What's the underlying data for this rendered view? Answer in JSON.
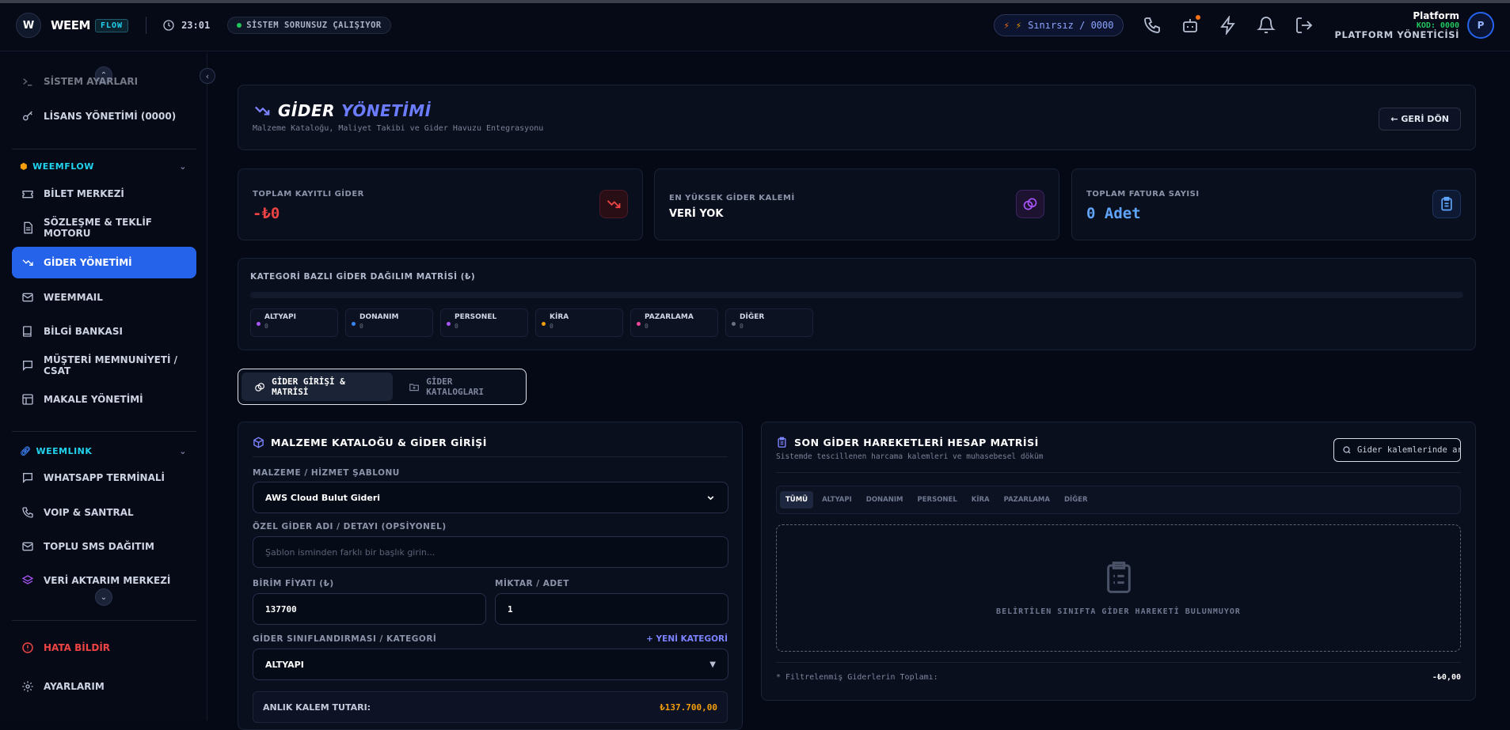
{
  "topbar": {
    "logo_letter": "W",
    "brand": "WEEM",
    "brand_tag": "FLOW",
    "time": "23:01",
    "system_status": "SİSTEM SORUNSUZ ÇALIŞIYOR",
    "credit": "Sınırsız / 0000",
    "user_name": "Platform",
    "user_code": "KOD: 0000",
    "user_role": "PLATFORM YÖNETİCİSİ",
    "avatar_letter": "P"
  },
  "sidebar": {
    "items_top": [
      {
        "label": "SİSTEM AYARLARI",
        "icon": "terminal-icon"
      },
      {
        "label": "LİSANS YÖNETİMİ (0000)",
        "icon": "key-icon"
      }
    ],
    "section_weemflow": "WEEMFLOW",
    "items_flow": [
      {
        "label": "BİLET MERKEZİ",
        "icon": "ticket-icon"
      },
      {
        "label": "SÖZLEŞME & TEKLİF MOTORU",
        "icon": "document-icon"
      },
      {
        "label": "GİDER YÖNETİMİ",
        "icon": "trending-down-icon"
      },
      {
        "label": "WEEMMAIL",
        "icon": "mail-icon"
      },
      {
        "label": "BİLGİ BANKASI",
        "icon": "book-icon"
      },
      {
        "label": "MÜŞTERİ MEMNUNİYETİ / CSAT",
        "icon": "chat-icon"
      },
      {
        "label": "MAKALE YÖNETİMİ",
        "icon": "layout-icon"
      }
    ],
    "section_weemlink": "WEEMLINK",
    "items_link": [
      {
        "label": "WHATSAPP TERMİNALİ",
        "icon": "chat-icon"
      },
      {
        "label": "VOIP & SANTRAL",
        "icon": "phone-icon"
      },
      {
        "label": "TOPLU SMS DAĞITIM",
        "icon": "mail-icon"
      },
      {
        "label": "VERİ AKTARIM MERKEZİ",
        "icon": "layers-icon"
      }
    ],
    "report_bug": "HATA BİLDİR",
    "settings": "AYARLARIM"
  },
  "header": {
    "title_a": "GİDER",
    "title_b": "YÖNETİMİ",
    "subtitle": "Malzeme Kataloğu, Maliyet Takibi ve Gider Havuzu Entegrasyonu",
    "back": "← GERİ DÖN"
  },
  "stats": {
    "total_label": "TOPLAM KAYITLI GİDER",
    "total_value": "-₺0",
    "top_label": "EN YÜKSEK GİDER KALEMİ",
    "top_value": "VERİ YOK",
    "invoice_label": "TOPLAM FATURA SAYISI",
    "invoice_value": "0 Adet"
  },
  "matrix": {
    "title": "KATEGORİ BAZLI GİDER DAĞILIM MATRİSİ (₺)",
    "categories": [
      {
        "name": "ALTYAPI",
        "value": "0",
        "color": "#a855f7"
      },
      {
        "name": "DONANIM",
        "value": "0",
        "color": "#3b82f6"
      },
      {
        "name": "PERSONEL",
        "value": "0",
        "color": "#a855f7"
      },
      {
        "name": "KİRA",
        "value": "0",
        "color": "#f59e0b"
      },
      {
        "name": "PAZARLAMA",
        "value": "0",
        "color": "#ec4899"
      },
      {
        "name": "DİĞER",
        "value": "0",
        "color": "#6b7280"
      }
    ]
  },
  "tabs": {
    "entry": "GİDER GİRİŞİ & MATRİSİ",
    "catalogs": "GİDER KATALOGLARI"
  },
  "form": {
    "title": "MALZEME KATALOĞU & GİDER GİRİŞİ",
    "template_label": "MALZEME / HİZMET ŞABLONU",
    "template_value": "AWS Cloud Bulut Gideri",
    "custom_label": "ÖZEL GİDER ADI / DETAYI (OPSİYONEL)",
    "custom_placeholder": "Şablon isminden farklı bir başlık girin...",
    "price_label": "BİRİM FİYATI (₺)",
    "price_value": "137700",
    "qty_label": "MİKTAR / ADET",
    "qty_value": "1",
    "category_label": "GİDER SINIFLANDIRMASI / KATEGORİ",
    "new_category": "+ YENİ KATEGORİ",
    "category_value": "ALTYAPI",
    "instant_label": "ANLIK KALEM TUTARI:",
    "instant_value": "₺137.700,00"
  },
  "ledger": {
    "title": "SON GİDER HAREKETLERİ HESAP MATRİSİ",
    "subtitle": "Sistemde tescillenen harcama kalemleri ve muhasebesel döküm",
    "search_placeholder": "Gider kalemlerinde ara...",
    "filters": [
      "TÜMÜ",
      "ALTYAPI",
      "DONANIM",
      "PERSONEL",
      "KİRA",
      "PAZARLAMA",
      "DİĞER"
    ],
    "empty": "BELİRTİLEN SINIFTA GİDER HAREKETİ BULUNMUYOR",
    "total_label": "* Filtrelenmiş Giderlerin Toplamı:",
    "total_value": "-₺0,00"
  }
}
